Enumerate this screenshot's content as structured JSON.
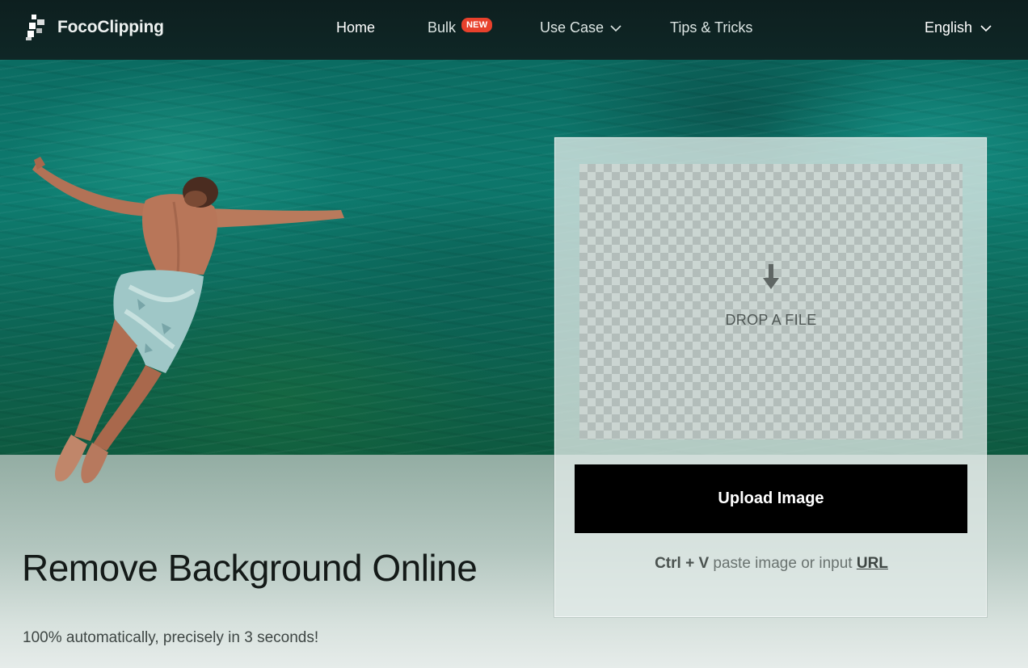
{
  "header": {
    "brand": "FocoClipping",
    "nav": [
      {
        "label": "Home",
        "active": true
      },
      {
        "label": "Bulk",
        "badge": "NEW"
      },
      {
        "label": "Use Case",
        "dropdown": true
      },
      {
        "label": "Tips & Tricks"
      }
    ],
    "language": "English"
  },
  "hero": {
    "title": "Remove Background Online",
    "subtitle": "100% automatically, precisely in 3 seconds!"
  },
  "upload": {
    "drop_label": "DROP A FILE",
    "button_label": "Upload Image",
    "paste_shortcut": "Ctrl + V",
    "paste_text": " paste image or input ",
    "url_label": "URL"
  },
  "colors": {
    "header_bg": "#0d1f1f",
    "badge": "#e8412c",
    "button_bg": "#000000",
    "water": "#0b6c62"
  },
  "icons": {
    "logo": "pixel-logo-icon",
    "dropdown": "chevron-down-icon",
    "drop": "arrow-down-icon"
  }
}
